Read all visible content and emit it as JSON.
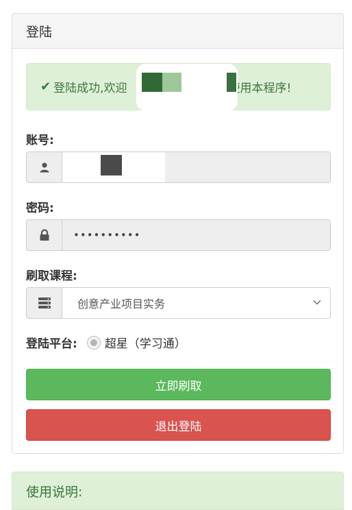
{
  "panel": {
    "title": "登陆"
  },
  "alert": {
    "prefix": "登陆成功,欢迎",
    "suffix": "使用本程序!"
  },
  "account": {
    "label": "账号:"
  },
  "password": {
    "label": "密码:",
    "value": "••••••••••"
  },
  "course": {
    "label": "刷取课程:",
    "selected": "创意产业项目实务"
  },
  "platform": {
    "label": "登陆平台:",
    "option": "超星（学习通）"
  },
  "buttons": {
    "start": "立即刷取",
    "logout": "退出登陆"
  },
  "instructions": {
    "title": "使用说明:"
  },
  "colors": {
    "success": "#5cb85c",
    "danger": "#d9534f",
    "alert_bg": "#dff0d8",
    "alert_text": "#3c763d"
  }
}
